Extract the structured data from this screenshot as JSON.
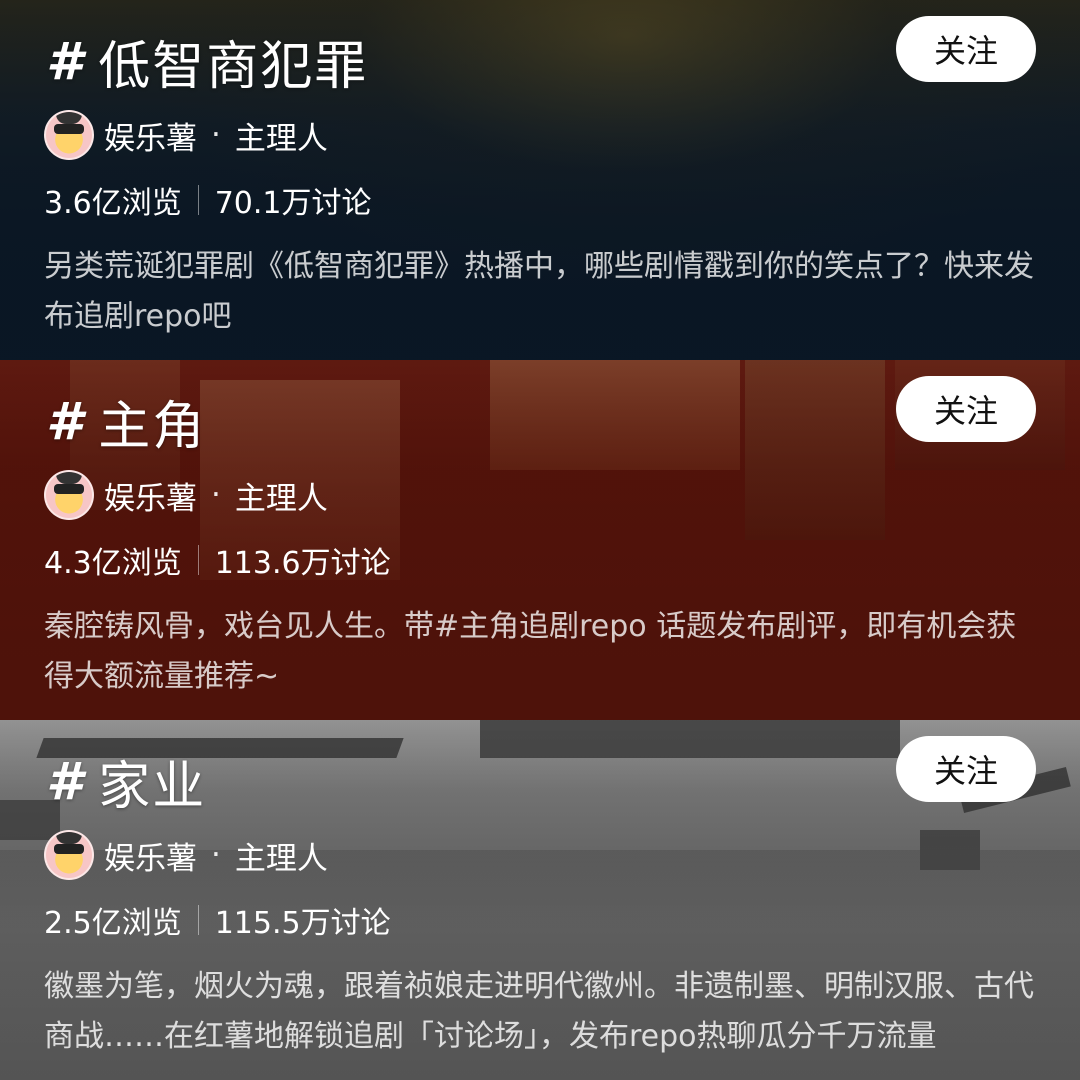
{
  "cards": [
    {
      "hash": "#",
      "title": "低智商犯罪",
      "follow_label": "关注",
      "host_name": "娱乐薯",
      "host_sep": "·",
      "host_role": "主理人",
      "views": "3.6亿浏览",
      "discussions": "70.1万讨论",
      "description": "另类荒诞犯罪剧《低智商犯罪》热播中，哪些剧情戳到你的笑点了？快来发布追剧repo吧"
    },
    {
      "hash": "#",
      "title": "主角",
      "follow_label": "关注",
      "host_name": "娱乐薯",
      "host_sep": "·",
      "host_role": "主理人",
      "views": "4.3亿浏览",
      "discussions": "113.6万讨论",
      "description": "秦腔铸风骨，戏台见人生。带#主角追剧repo 话题发布剧评，即有机会获得大额流量推荐~"
    },
    {
      "hash": "#",
      "title": "家业",
      "follow_label": "关注",
      "host_name": "娱乐薯",
      "host_sep": "·",
      "host_role": "主理人",
      "views": "2.5亿浏览",
      "discussions": "115.5万讨论",
      "description": "徽墨为笔，烟火为魂，跟着祯娘走进明代徽州。非遗制墨、明制汉服、古代商战……在红薯地解锁追剧「讨论场」，发布repo热聊瓜分千万流量"
    }
  ]
}
